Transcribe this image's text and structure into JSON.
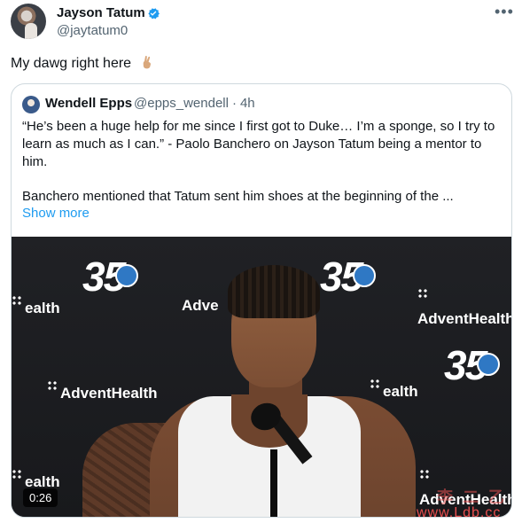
{
  "tweet": {
    "author_name": "Jayson Tatum",
    "author_handle": "@jaytatum0",
    "text": "My dawg right here",
    "emoji_icon": "crossed-fingers-emoji",
    "more_icon": "more-options-icon"
  },
  "quoted_tweet": {
    "author_name": "Wendell Epps",
    "author_handle": "@epps_wendell",
    "separator": "·",
    "time": "4h",
    "text_paragraph_1": "“He’s been a huge help for me since I first got to Duke… I’m a sponge, so I try to learn as much as I can.” - Paolo Banchero on Jayson Tatum being a mentor to him.",
    "text_paragraph_2": "Banchero mentioned that Tatum sent him shoes at the beginning of the ...",
    "show_more": "Show more",
    "media": {
      "type": "video",
      "duration": "0:26",
      "backdrop_texts": {
        "logo_number": "35",
        "sponsor": "AdventHealth",
        "sponsor_partial_left": "ealth",
        "sponsor_partial_mid": "Adve",
        "sponsor_partial_right": "ealth"
      }
    }
  },
  "watermark": {
    "chinese": "李 二 乙",
    "url": "www.Ldb.cc"
  },
  "colors": {
    "verified_blue": "#1d9bf0",
    "link_blue": "#1d9bf0",
    "secondary_text": "#536471",
    "border": "#cfd9de"
  }
}
